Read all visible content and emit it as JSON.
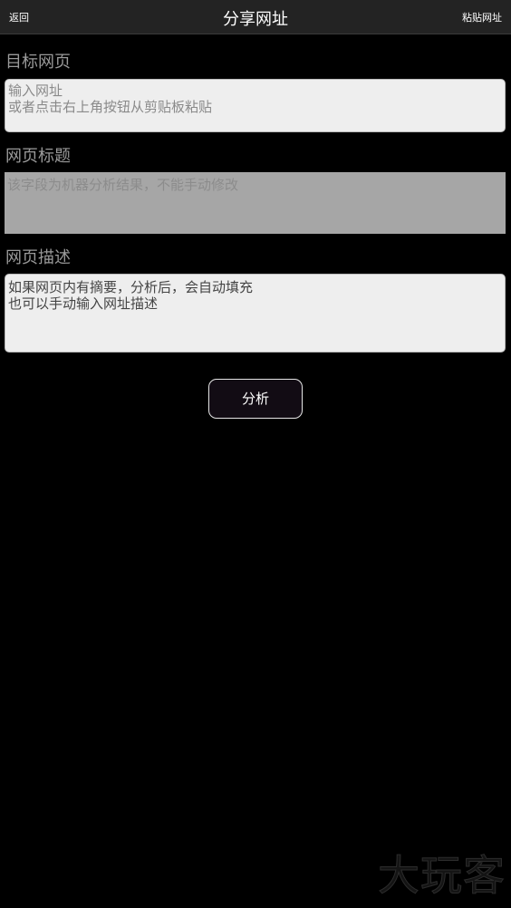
{
  "nav": {
    "back_label": "返回",
    "title": "分享网址",
    "paste_label": "粘贴网址"
  },
  "sections": {
    "url": {
      "label": "目标网页",
      "placeholder": "输入网址\n或者点击右上角按钮从剪贴板粘贴"
    },
    "title": {
      "label": "网页标题",
      "placeholder": "该字段为机器分析结果，不能手动修改"
    },
    "description": {
      "label": "网页描述",
      "placeholder": "如果网页内有摘要，分析后，会自动填充\n也可以手动输入网址描述"
    }
  },
  "analyze_button": "分析",
  "watermark": "大玩客"
}
